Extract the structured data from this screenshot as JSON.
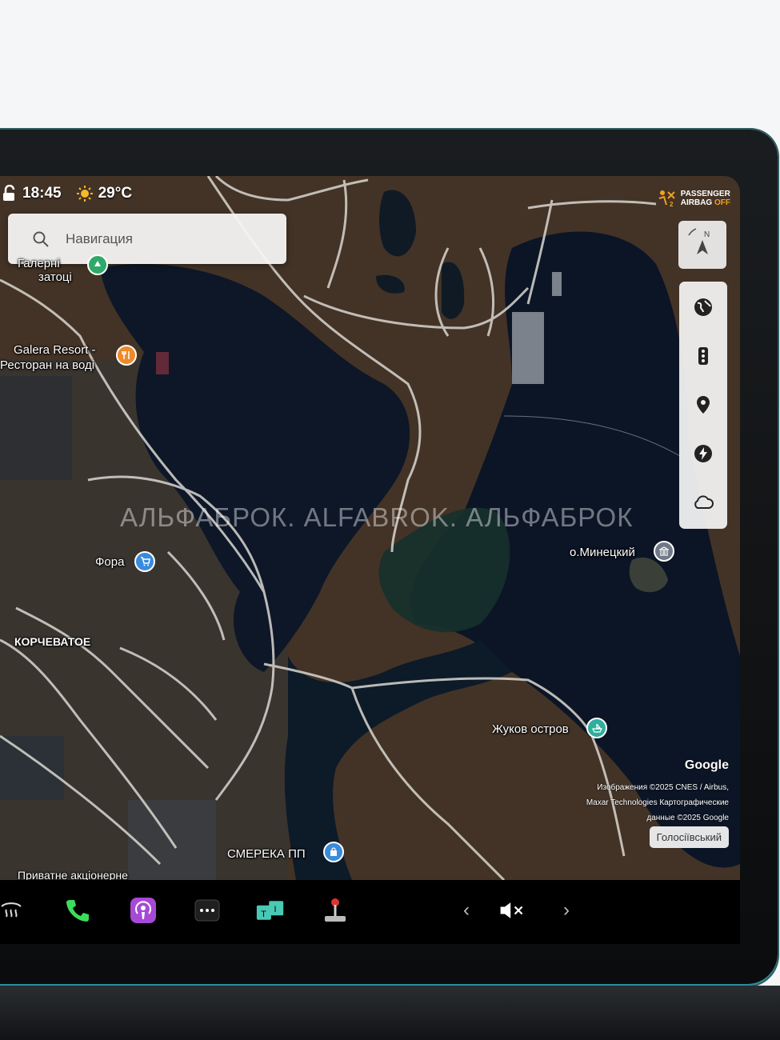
{
  "status": {
    "time": "18:45",
    "temperature": "29°C",
    "airbag_line1": "PASSENGER",
    "airbag_line2": "AIRBAG",
    "airbag_state": "OFF"
  },
  "search": {
    "placeholder": "Навигация"
  },
  "compass": {
    "letter": "N"
  },
  "controls": [
    "globe-icon",
    "traffic-light-icon",
    "pin-icon",
    "charging-icon",
    "weather-icon"
  ],
  "map": {
    "labels": {
      "zatoka_1": "Галерні",
      "zatoka_2": "затоці",
      "galera_1": "Galera Resort -",
      "galera_2": "Ресторан на воді",
      "fora": "Фора",
      "korchevatoe": "КОРЧЕВАТОЕ",
      "minetsky": "о.Минецкий",
      "zhukov": "Жуков остров",
      "smereka": "СМЕРЕКА ПП",
      "private": "Приватне акціонерне"
    },
    "watermark": "АЛЬФАБРОК. ALFABROK. АЛЬФАБРОК",
    "google": "Google",
    "attribution_1": "Изображения ©2025 CNES / Airbus,",
    "attribution_2": "Maxar Technologies Картографические",
    "attribution_3": "данные ©2025 Google",
    "district": "Голосіївський"
  },
  "dock": {
    "icons": [
      "defrost-icon",
      "phone-icon",
      "podcast-icon",
      "more-icon",
      "toybox-icon",
      "joystick-icon"
    ],
    "prev": "‹",
    "next": "›"
  },
  "colors": {
    "water": "#0e1a2b",
    "land": "#4a3a2c",
    "road": "#d9d6d0",
    "phone": "#3ddc5a",
    "podcast": "#a64ad6",
    "toybox": "#49c9b4",
    "joystick": "#d33"
  }
}
